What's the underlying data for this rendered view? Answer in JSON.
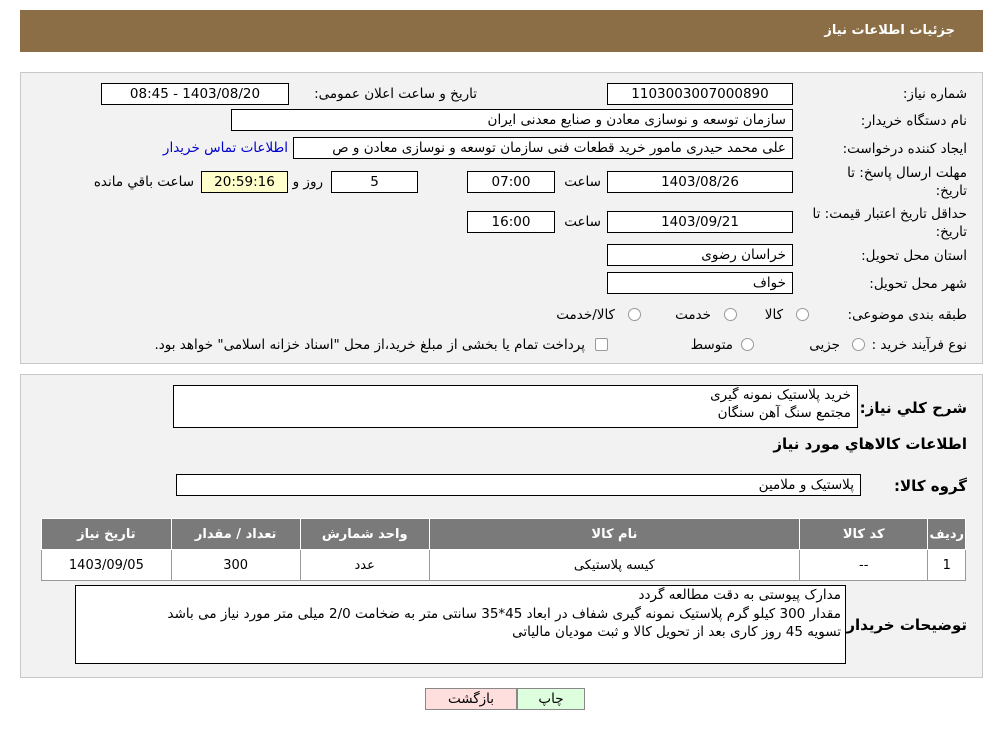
{
  "header": {
    "title": "جزئیات اطلاعات نیاز"
  },
  "labels": {
    "need_number": "شماره نیاز:",
    "announce_date": "تاریخ و ساعت اعلان عمومی:",
    "buyer_org": "نام دستگاه خریدار:",
    "creator": "ایجاد کننده درخواست:",
    "deadline": "مهلت ارسال پاسخ: تا تاریخ:",
    "deadline_line1": "مهلت ارسال پاسخ: تا",
    "deadline_line2": "تاریخ:",
    "time": "ساعت",
    "day_and": "روز و",
    "remaining": "ساعت باقي مانده",
    "price_validity_line1": "حداقل تاریخ اعتبار قیمت: تا",
    "price_validity_line2": "تاریخ:",
    "province": "استان محل تحویل:",
    "city": "شهر محل تحویل:",
    "category": "طبقه بندی موضوعی:",
    "purchase_type": "نوع فرآیند خرید :",
    "need_desc": "شرح کلي نياز:",
    "goods_info": "اطلاعات کالاهاي مورد نياز",
    "goods_group": "گروه کالا:",
    "buyer_notes": "توضیحات خریدار:"
  },
  "values": {
    "need_number": "1103003007000890",
    "announce_date": "1403/08/20 - 08:45",
    "buyer_org": "سازمان توسعه و نوسازی معادن و صنایع معدنی ایران",
    "creator": "علی محمد حیدری مامور خرید قطعات فنی سازمان توسعه و نوسازی معادن و ص",
    "contact_link": "اطلاعات تماس خریدار",
    "deadline_date": "1403/08/26",
    "deadline_time": "07:00",
    "days": "5",
    "remaining_time": "20:59:16",
    "price_validity_date": "1403/09/21",
    "price_validity_time": "16:00",
    "province": "خراسان رضوی",
    "city": "خواف",
    "goods_group": "پلاستیک و ملامین"
  },
  "category_options": [
    "کالا",
    "خدمت",
    "کالا/خدمت"
  ],
  "purchase_options": [
    "جزیی",
    "متوسط"
  ],
  "purchase_note": "پرداخت تمام یا بخشی از مبلغ خرید،از محل \"اسناد خزانه اسلامی\" خواهد بود.",
  "need_desc_lines": [
    "خرید پلاستیک نمونه گیری",
    "مجتمع سنگ آهن سنگان"
  ],
  "table": {
    "headers": [
      "ردیف",
      "کد کالا",
      "نام کالا",
      "واحد شمارش",
      "تعداد / مقدار",
      "تاریخ نیاز"
    ],
    "rows": [
      [
        "1",
        "--",
        "کیسه پلاستیکی",
        "عدد",
        "300",
        "1403/09/05"
      ]
    ]
  },
  "buyer_notes_lines": [
    "مدارک پیوستی به دقت مطالعه گردد",
    "مقدار 300 کیلو گرم پلاستیک نمونه گیری شفاف  در ابعاد 45*35 سانتی متر به ضخامت 2/0 میلی متر مورد نیاز می باشد",
    "تسویه 45 روز کاری بعد از تحویل کالا و ثبت مودیان مالیاتی"
  ],
  "buttons": {
    "print": "چاپ",
    "back": "بازگشت"
  },
  "colors": {
    "header": "#8b6e45",
    "table_header": "#7a7a7a",
    "back_button": "#ffdede",
    "print_button": "#ddffdd"
  }
}
